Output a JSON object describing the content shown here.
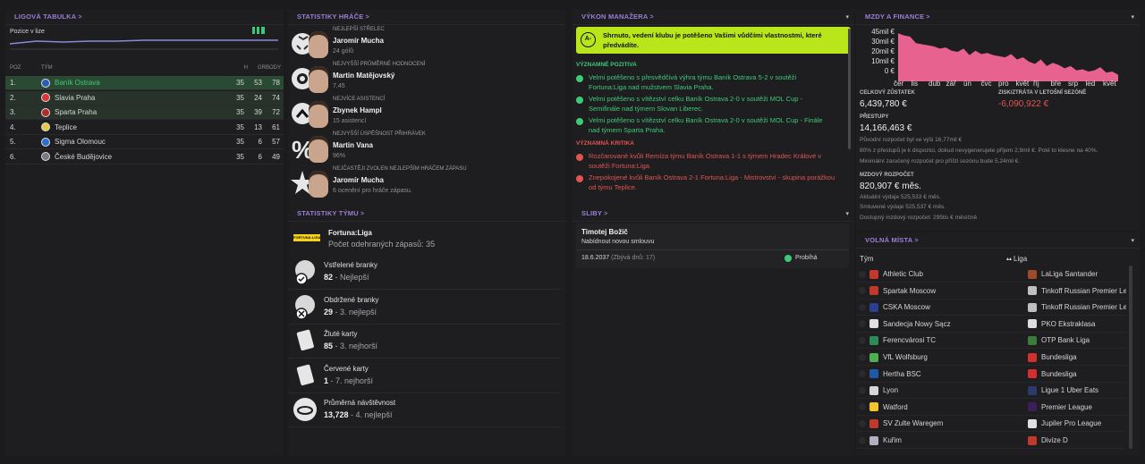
{
  "league": {
    "title": "LIGOVÁ TABULKA",
    "position_label": "Pozice v lize",
    "columns": {
      "pos": "POZ",
      "team": "TÝM",
      "h": "H",
      "gr": "GR",
      "pts": "BODY"
    },
    "rows": [
      {
        "pos": "1.",
        "team": "Baník Ostrava",
        "h": "35",
        "gr": "53",
        "pts": "78",
        "crest": "#2a5db8"
      },
      {
        "pos": "2.",
        "team": "Slavia Praha",
        "h": "35",
        "gr": "24",
        "pts": "74",
        "crest": "#d93535"
      },
      {
        "pos": "3.",
        "team": "Sparta Praha",
        "h": "35",
        "gr": "39",
        "pts": "72",
        "crest": "#b32a2a"
      },
      {
        "pos": "4.",
        "team": "Teplice",
        "h": "35",
        "gr": "13",
        "pts": "61",
        "crest": "#e8c84a"
      },
      {
        "pos": "5.",
        "team": "Sigma Olomouc",
        "h": "35",
        "gr": "6",
        "pts": "57",
        "crest": "#2a6fd1"
      },
      {
        "pos": "6.",
        "team": "České Budějovice",
        "h": "35",
        "gr": "6",
        "pts": "49",
        "crest": "#7a7a80"
      }
    ]
  },
  "players": {
    "title": "STATISTIKY HRÁČE",
    "rows": [
      {
        "label": "NEJLEPŠÍ STŘELEC",
        "name": "Jaromír Mucha",
        "sub": "24 gólů",
        "icon": "ball-icon"
      },
      {
        "label": "NEJVYŠŠÍ PRŮMĚRNÉ HODNOCENÍ",
        "name": "Martin Matějovský",
        "sub": "7,45",
        "icon": "rating-icon"
      },
      {
        "label": "NEJVÍCE ASISTENCÍ",
        "name": "Zbynek Hampl",
        "sub": "15 asistencí",
        "icon": "assist-icon"
      },
      {
        "label": "NEJVYŠŠÍ ÚSPĚŠNOST PŘIHRÁVEK",
        "name": "Martin Vana",
        "sub": "96%",
        "icon": "percent-icon"
      },
      {
        "label": "NEJČASTĚJI ZVOLEN NEJLEPŠÍM HRÁČEM ZÁPASU",
        "name": "Jaromír Mucha",
        "sub": "6 ocenění pro hráče zápasu.",
        "icon": "star-icon"
      }
    ]
  },
  "team": {
    "title": "STATISTIKY TÝMU",
    "league_name": "Fortuna:Liga",
    "league_logo_text": "FORTUNA:LIGA",
    "matches": "Počet odehraných zápasů: 35",
    "rows": [
      {
        "label": "Vstřelené branky",
        "value": "82",
        "rank": " - Nejlepší"
      },
      {
        "label": "Obdržené branky",
        "value": "29",
        "rank": " - 3. nejlepší"
      },
      {
        "label": "Žluté karty",
        "value": "85",
        "rank": " - 3. nejhorší"
      },
      {
        "label": "Červené karty",
        "value": "1",
        "rank": " - 7. nejhorší"
      },
      {
        "label": "Průměrná návštěvnost",
        "value": "13,728",
        "rank": " - 4. nejlepší"
      }
    ]
  },
  "manager": {
    "title": "VÝKON MANAŽERA",
    "grade": "A-",
    "summary": "Shrnuto, vedení klubu je potěšeno Vašimi vůdčími vlastnostmi, které předvádíte.",
    "positives_title": "VÝZNAMNÉ POZITIVA",
    "positives": [
      "Velmi potěšeno s přesvědčivá výhra týmu Baník Ostrava 5-2 v soutěži Fortuna:Liga nad mužstvem Slavia Praha.",
      "Velmi potěšeno s vítězství celku Baník Ostrava 2-0 v soutěži MOL Cup - Semifinále nad týmem Slovan Liberec.",
      "Velmi potěšeno s vítězství celku Baník Ostrava 2-0 v soutěži MOL Cup - Finále nad týmem Sparta Praha."
    ],
    "criticism_title": "VÝZNAMNÁ KRITIKA",
    "criticism": [
      "Rozčarované kvůli Remíza týmu Baník Ostrava 1-1 s týmem Hradec Králové v soutěži Fortuna:Liga.",
      "Znepokojené kvůli Baník Ostrava 2-1 Fortuna:Liga - Mistrovství - skupina porážkou od týmu Teplice."
    ]
  },
  "promises": {
    "title": "SLIBY",
    "player": "Timotej Božič",
    "promise": "Nabídnout novou smlouvu",
    "date": "18.6.2037",
    "remaining": "(Zbývá dnů: 17)",
    "status": "Probíhá"
  },
  "finance": {
    "title": "MZDY A FINANCE",
    "y_ticks": [
      "45mil €",
      "30mil €",
      "20mil €",
      "10mil €",
      "0 €"
    ],
    "months": [
      "čer",
      "lis",
      "dub",
      "zář",
      "ún",
      "čvc",
      "pro",
      "květ",
      "říj",
      "bře",
      "srp",
      "led",
      "květ"
    ],
    "balance_label": "CELKOVÝ ZŮSTATEK",
    "balance": "6,439,780 €",
    "pl_label": "ZISK/ZTRÁTA V LETOŠNÍ SEZÓNĚ",
    "pl": "-6,090,922 €",
    "transfers_label": "PŘESTUPY",
    "transfers": "14,166,463 €",
    "transfers_note1": "Původní rozpočet byl ve výši 16,77mil €",
    "transfers_note2": "80% z přestupů je k dispozici, dokud nevygenerujete příjem 2,9mil €. Poté to klesne na 40%.",
    "transfers_note3": "Minimální zaručený rozpočet pro příští sezónu bude 5,24mil €.",
    "wage_label": "MZDOVÝ ROZPOČET",
    "wage": "820,907 € měs.",
    "wage_note1": "Aktuální výdaje 525,533 € měs.",
    "wage_note2": "Smluvené výdaje 525,537 € měs.",
    "wage_note3": "Dostupný mzdový rozpočet: 295tis € měsíčně",
    "chart_color": "#e8628f"
  },
  "vacancies": {
    "title": "VOLNÁ MÍSTA",
    "col_team": "Tým",
    "col_league": "Liga",
    "rows": [
      {
        "team": "Athletic Club",
        "league": "LaLiga Santander",
        "tc": "#c0392b",
        "lc": "#a04a2a"
      },
      {
        "team": "Spartak Moscow",
        "league": "Tinkoff Russian Premier Le...",
        "tc": "#c0392b",
        "lc": "#bfbfc2"
      },
      {
        "team": "CSKA Moscow",
        "league": "Tinkoff Russian Premier Le...",
        "tc": "#2c3e8f",
        "lc": "#bfbfc2"
      },
      {
        "team": "Sandecja Nowy Sącz",
        "league": "PKO Ekstraklasa",
        "tc": "#e0e0e0",
        "lc": "#dddddd"
      },
      {
        "team": "Ferencvárosi TC",
        "league": "OTP Bank Liga",
        "tc": "#2e8b57",
        "lc": "#3a7d3a"
      },
      {
        "team": "VfL Wolfsburg",
        "league": "Bundesliga",
        "tc": "#4caf50",
        "lc": "#d32f2f"
      },
      {
        "team": "Hertha BSC",
        "league": "Bundesliga",
        "tc": "#1e5aa8",
        "lc": "#d32f2f"
      },
      {
        "team": "Lyon",
        "league": "Ligue 1 Uber Eats",
        "tc": "#d6d6d6",
        "lc": "#2a3a6a"
      },
      {
        "team": "Watford",
        "league": "Premier League",
        "tc": "#f4c430",
        "lc": "#3c1e5a"
      },
      {
        "team": "SV Zulte Waregem",
        "league": "Jupiler Pro League",
        "tc": "#c0392b",
        "lc": "#e0e0e0"
      },
      {
        "team": "Kuřim",
        "league": "Divize D",
        "tc": "#b0b0c0",
        "lc": "#c0392b"
      }
    ]
  }
}
